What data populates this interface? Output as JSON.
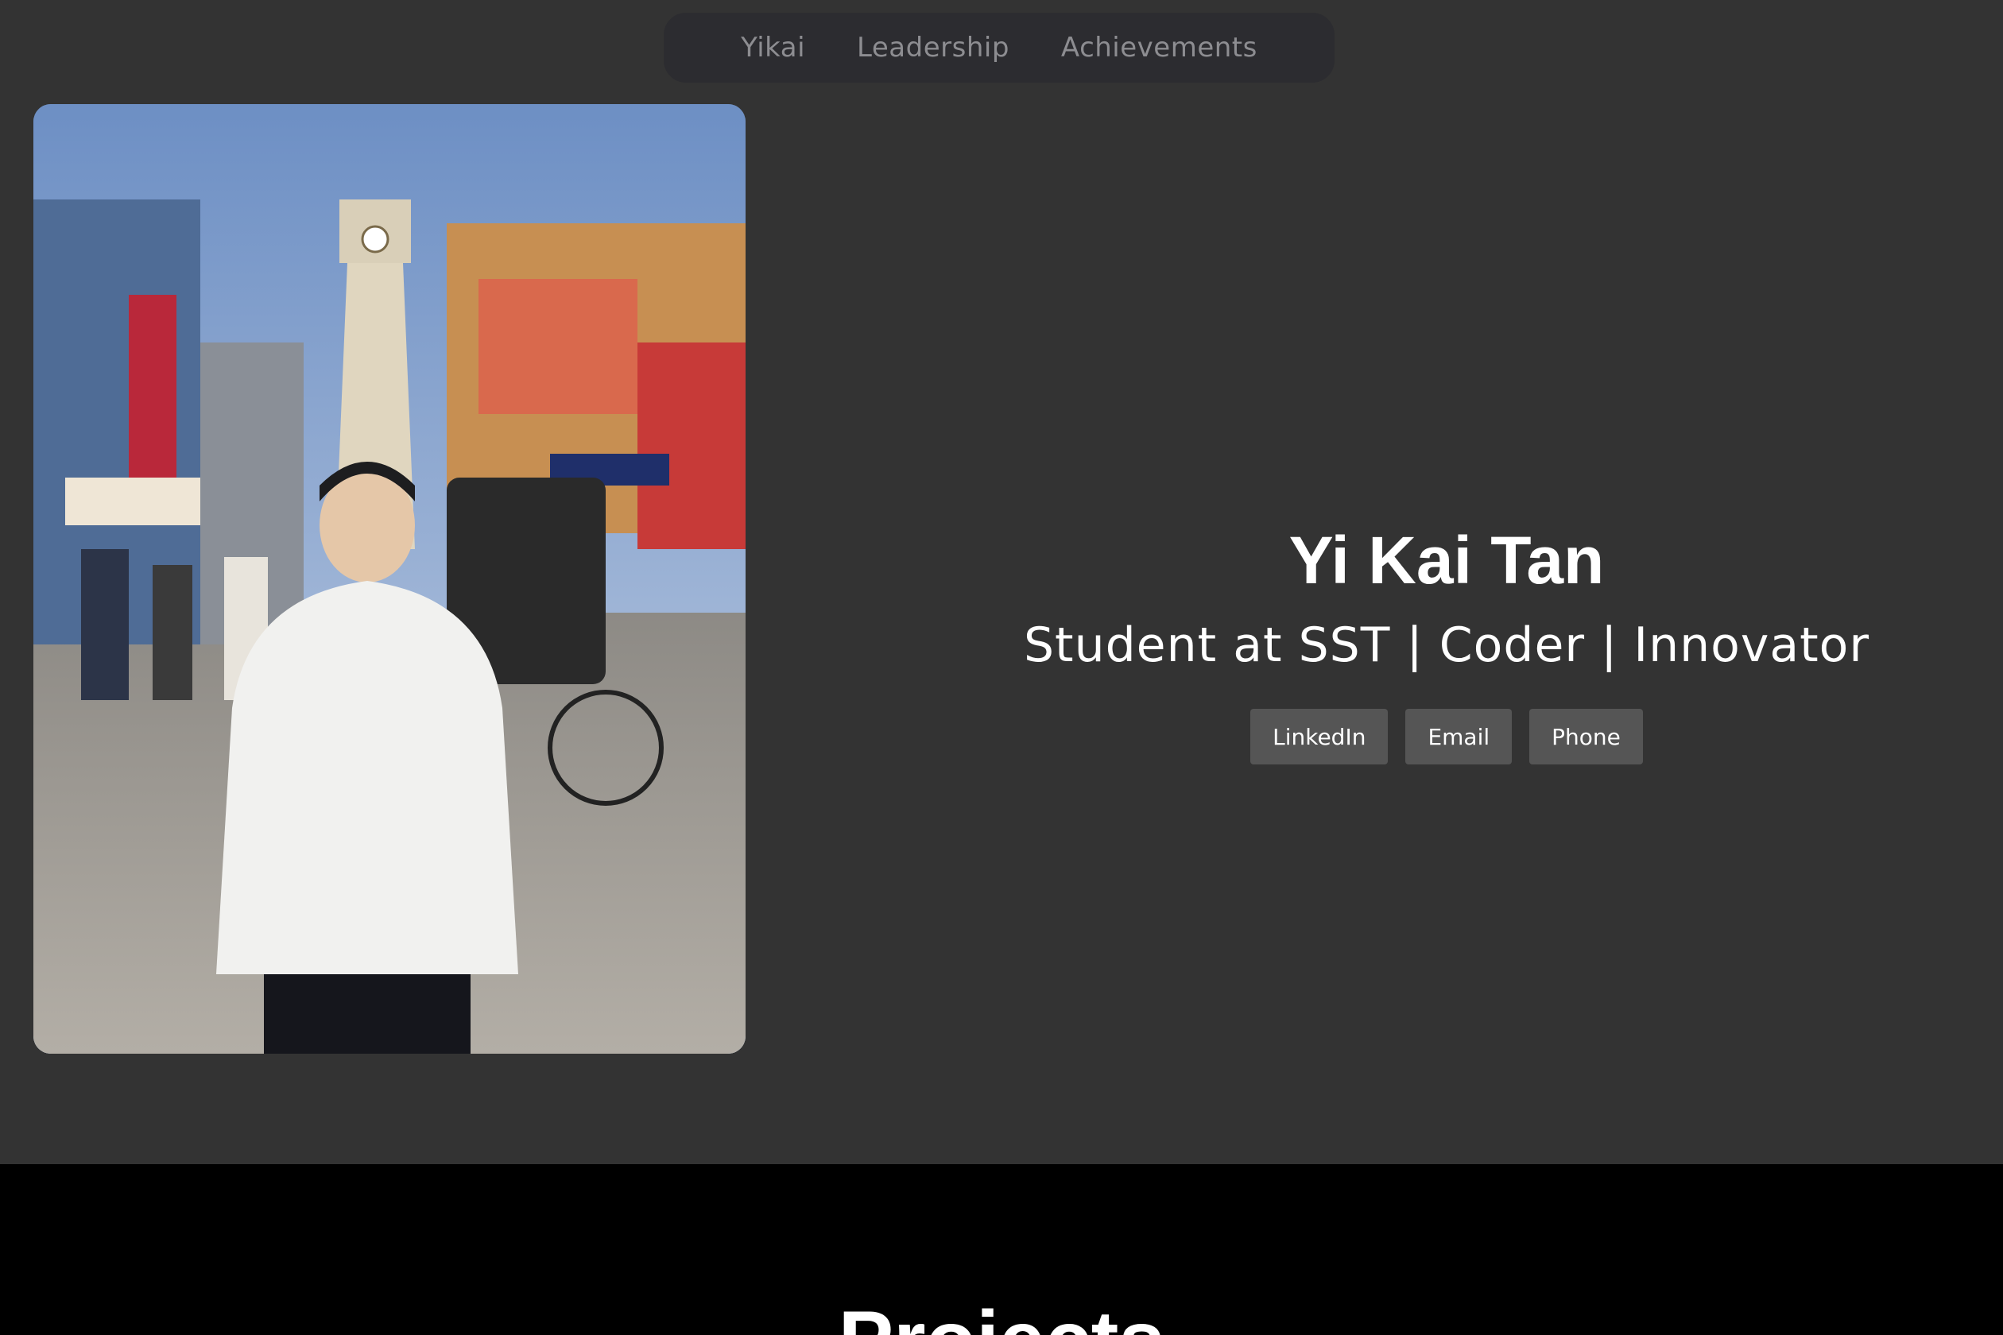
{
  "nav": {
    "items": [
      {
        "label": "Yikai"
      },
      {
        "label": "Leadership"
      },
      {
        "label": "Achievements"
      }
    ]
  },
  "hero": {
    "name": "Yi Kai Tan",
    "tagline": "Student at SST | Coder | Innovator",
    "buttons": [
      {
        "label": "LinkedIn"
      },
      {
        "label": "Email"
      },
      {
        "label": "Phone"
      }
    ]
  },
  "projects": {
    "title": "Projects"
  },
  "colors": {
    "page_background": "#333333",
    "navbar_background": "#2c2c30",
    "nav_text": "#8d8d91",
    "button_background": "#555555",
    "projects_background": "#000000"
  }
}
